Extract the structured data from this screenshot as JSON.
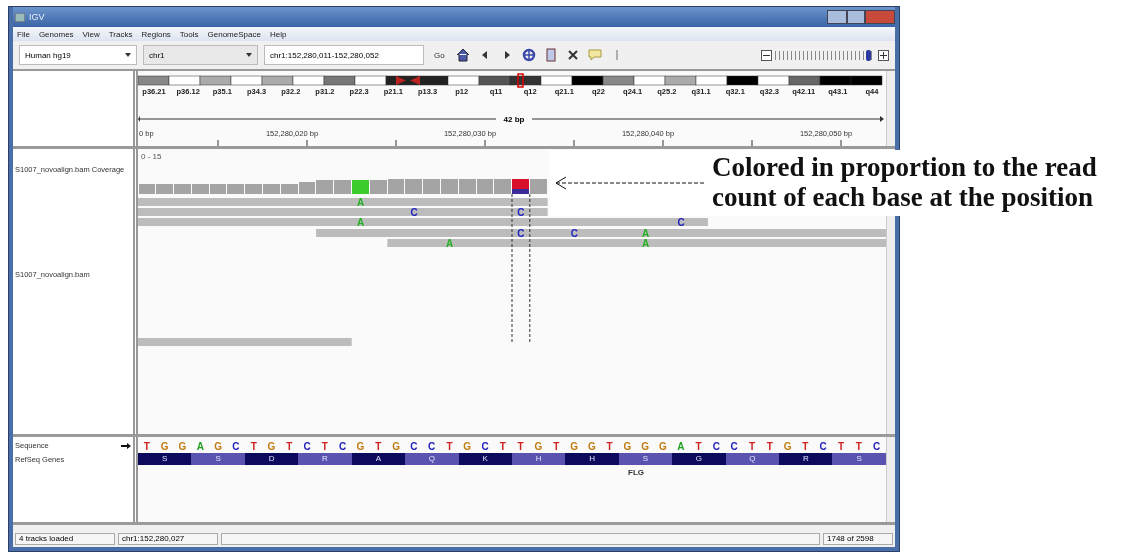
{
  "window": {
    "title": "IGV"
  },
  "menu": [
    "File",
    "Genomes",
    "View",
    "Tracks",
    "Regions",
    "Tools",
    "GenomeSpace",
    "Help"
  ],
  "toolbar": {
    "genome": "Human hg19",
    "chromosome": "chr1",
    "locus": "chr1:152,280,011-152,280,052",
    "go": "Go",
    "zoom": {
      "level": 0.96
    }
  },
  "ideogram": {
    "bands": [
      "p36.21",
      "p36.12",
      "p35.1",
      "p34.3",
      "p32.2",
      "p31.2",
      "p22.3",
      "p21.1",
      "p13.3",
      "p12",
      "q11",
      "q12",
      "q21.1",
      "q22",
      "q24.1",
      "q25.2",
      "q31.1",
      "q32.1",
      "q32.3",
      "q42.11",
      "q43.1",
      "q44"
    ]
  },
  "ruler": {
    "span": "42 bp",
    "ticks": [
      "0 bp",
      "152,280,020 bp",
      "152,280,030 bp",
      "152,280,040 bp",
      "152,280,050 bp"
    ]
  },
  "tracks": [
    {
      "name": "S1007_novoalign.bam Coverage",
      "range": "0 - 15"
    },
    {
      "name": "S1007_novoalign.bam"
    },
    {
      "name": "Sequence"
    },
    {
      "name": "RefSeq Genes"
    }
  ],
  "coverage": [
    {
      "level": 0.5,
      "color": "#a4a4a4"
    },
    {
      "level": 0.5,
      "color": "#a4a4a4"
    },
    {
      "level": 0.5,
      "color": "#a4a4a4"
    },
    {
      "level": 0.5,
      "color": "#a4a4a4"
    },
    {
      "level": 0.5,
      "color": "#a4a4a4"
    },
    {
      "level": 0.5,
      "color": "#a4a4a4"
    },
    {
      "level": 0.5,
      "color": "#a4a4a4"
    },
    {
      "level": 0.5,
      "color": "#a4a4a4"
    },
    {
      "level": 0.5,
      "color": "#a4a4a4"
    },
    {
      "level": 0.6,
      "color": "#a4a4a4"
    },
    {
      "level": 0.7,
      "color": "#a4a4a4"
    },
    {
      "level": 0.7,
      "color": "#a4a4a4"
    },
    {
      "level": 0.7,
      "color": "#3ccc2c"
    },
    {
      "level": 0.7,
      "color": "#a4a4a4"
    },
    {
      "level": 0.75,
      "color": "#a4a4a4"
    },
    {
      "level": 0.75,
      "color": "#a4a4a4"
    },
    {
      "level": 0.75,
      "color": "#a4a4a4"
    },
    {
      "level": 0.75,
      "color": "#a4a4a4"
    },
    {
      "level": 0.75,
      "color": "#a4a4a4"
    },
    {
      "level": 0.75,
      "color": "#a4a4a4"
    },
    {
      "level": 0.75,
      "color": "#a4a4a4"
    },
    {
      "level": 0.75,
      "color": "#d8102c",
      "kind": "split",
      "lower": {
        "color": "#3a2c9a"
      }
    },
    {
      "level": 0.75,
      "color": "#a4a4a4"
    }
  ],
  "reads": [
    {
      "kind": "read",
      "mismatches": [
        {
          "base": "A",
          "color": "#22b022"
        }
      ]
    },
    {
      "kind": "read",
      "mismatches": [
        {
          "base": "C",
          "color": "#2020c0"
        },
        {
          "base": "C",
          "color": "#2020c0"
        }
      ]
    },
    {
      "kind": "read",
      "mismatches": [
        {
          "base": "A",
          "color": "#22b022"
        },
        {
          "base": "C",
          "color": "#2020c0"
        }
      ]
    },
    {
      "kind": "read",
      "mismatches": [
        {
          "base": "C",
          "color": "#2020c0"
        },
        {
          "base": "C",
          "color": "#2020c0"
        },
        {
          "base": "A",
          "color": "#22b022"
        }
      ]
    },
    {
      "kind": "read",
      "mismatches": [
        {
          "base": "A",
          "color": "#22b022"
        },
        {
          "base": "A",
          "color": "#22b022"
        }
      ]
    },
    {
      "kind": "read"
    }
  ],
  "sequence": [
    {
      "base": "T",
      "color": "#d02020"
    },
    {
      "base": "G",
      "color": "#c07a10"
    },
    {
      "base": "G",
      "color": "#c07a10"
    },
    {
      "base": "A",
      "color": "#20a020"
    },
    {
      "base": "G",
      "color": "#c07a10"
    },
    {
      "base": "C",
      "color": "#2020c0"
    },
    {
      "base": "T",
      "color": "#d02020"
    },
    {
      "base": "G",
      "color": "#c07a10"
    },
    {
      "base": "T",
      "color": "#d02020"
    },
    {
      "base": "C",
      "color": "#2020c0"
    },
    {
      "base": "T",
      "color": "#d02020"
    },
    {
      "base": "C",
      "color": "#2020c0"
    },
    {
      "base": "G",
      "color": "#c07a10"
    },
    {
      "base": "T",
      "color": "#d02020"
    },
    {
      "base": "G",
      "color": "#c07a10"
    },
    {
      "base": "C",
      "color": "#2020c0"
    },
    {
      "base": "C",
      "color": "#2020c0"
    },
    {
      "base": "T",
      "color": "#d02020"
    },
    {
      "base": "G",
      "color": "#c07a10"
    },
    {
      "base": "C",
      "color": "#2020c0"
    },
    {
      "base": "T",
      "color": "#d02020"
    },
    {
      "base": "T",
      "color": "#d02020"
    },
    {
      "base": "G",
      "color": "#c07a10"
    },
    {
      "base": "T",
      "color": "#d02020"
    },
    {
      "base": "G",
      "color": "#c07a10"
    },
    {
      "base": "G",
      "color": "#c07a10"
    },
    {
      "base": "T",
      "color": "#d02020"
    },
    {
      "base": "G",
      "color": "#c07a10"
    },
    {
      "base": "G",
      "color": "#c07a10"
    },
    {
      "base": "G",
      "color": "#c07a10"
    },
    {
      "base": "A",
      "color": "#20a020"
    },
    {
      "base": "T",
      "color": "#d02020"
    },
    {
      "base": "C",
      "color": "#2020c0"
    },
    {
      "base": "C",
      "color": "#2020c0"
    },
    {
      "base": "T",
      "color": "#d02020"
    },
    {
      "base": "T",
      "color": "#d02020"
    },
    {
      "base": "G",
      "color": "#c07a10"
    },
    {
      "base": "T",
      "color": "#d02020"
    },
    {
      "base": "C",
      "color": "#2020c0"
    },
    {
      "base": "T",
      "color": "#d02020"
    },
    {
      "base": "T",
      "color": "#d02020"
    },
    {
      "base": "C",
      "color": "#2020c0"
    }
  ],
  "gene": {
    "name": "FLG",
    "amino_acids": [
      "S",
      "S",
      "D",
      "R",
      "A",
      "Q",
      "K",
      "H",
      "H",
      "S",
      "G",
      "Q",
      "R",
      "S"
    ]
  },
  "status_bar": {
    "message": "4 tracks loaded",
    "position": "chr1:152,280,027",
    "memory": "1748 of 2598"
  },
  "annotation": {
    "text": "Colored in proportion to the read count of each base at the position"
  }
}
